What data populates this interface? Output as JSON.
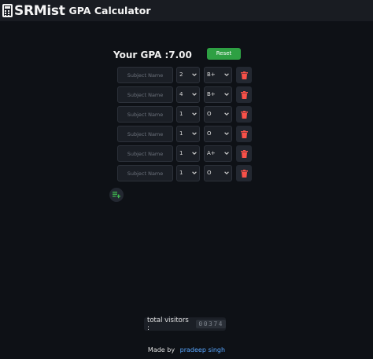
{
  "header": {
    "brand": "SRMist",
    "subtitle": "GPA Calculator",
    "icon": "calculator-icon"
  },
  "gpa": {
    "label": "Your GPA :7.00"
  },
  "reset_label": "Reset",
  "subject_placeholder": "Subject Name",
  "rows": [
    {
      "subject": "",
      "credit": "2",
      "grade": "B+"
    },
    {
      "subject": "",
      "credit": "4",
      "grade": "B+"
    },
    {
      "subject": "",
      "credit": "1",
      "grade": "O"
    },
    {
      "subject": "",
      "credit": "1",
      "grade": "O"
    },
    {
      "subject": "",
      "credit": "1",
      "grade": "A+"
    },
    {
      "subject": "",
      "credit": "1",
      "grade": "O"
    }
  ],
  "icons": {
    "delete": "trash-icon",
    "add": "playlist-add-icon",
    "dropdown": "chevron-down-icon"
  },
  "colors": {
    "accent_green": "#2ea043",
    "delete_red": "#f85149",
    "link_blue": "#58a6ff",
    "background": "#0e1116"
  },
  "visitors": {
    "label": "total visitors :",
    "count": "00374"
  },
  "footer": {
    "made_by": "Made by",
    "author": "pradeep singh"
  }
}
